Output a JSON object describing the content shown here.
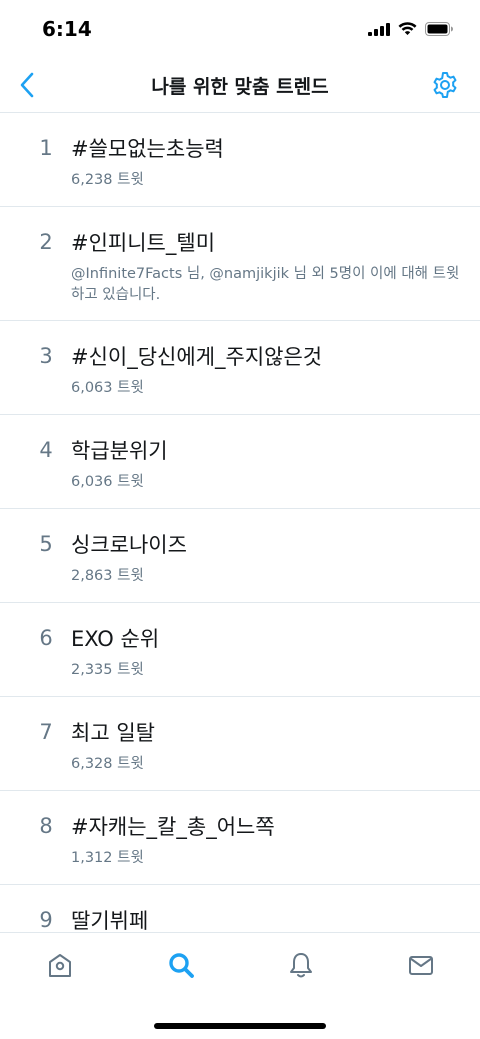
{
  "status_bar": {
    "time": "6:14"
  },
  "header": {
    "title": "나를 위한 맞춤 트렌드"
  },
  "trends": [
    {
      "rank": "1",
      "name": "#쓸모없는초능력",
      "meta": "6,238 트윗"
    },
    {
      "rank": "2",
      "name": "#인피니트_텔미",
      "meta": "@Infinite7Facts 님, @namjikjik 님 외 5명이 이에 대해 트윗하고 있습니다."
    },
    {
      "rank": "3",
      "name": "#신이_당신에게_주지않은것",
      "meta": "6,063 트윗"
    },
    {
      "rank": "4",
      "name": "학급분위기",
      "meta": "6,036 트윗"
    },
    {
      "rank": "5",
      "name": "싱크로나이즈",
      "meta": "2,863 트윗"
    },
    {
      "rank": "6",
      "name": "EXO 순위",
      "meta": "2,335 트윗"
    },
    {
      "rank": "7",
      "name": "최고 일탈",
      "meta": "6,328 트윗"
    },
    {
      "rank": "8",
      "name": "#자캐는_칼_총_어느쪽",
      "meta": "1,312 트윗"
    },
    {
      "rank": "9",
      "name": "딸기뷔페",
      "meta": ""
    }
  ],
  "tabs": [
    {
      "icon": "home-icon"
    },
    {
      "icon": "search-icon"
    },
    {
      "icon": "bell-icon"
    },
    {
      "icon": "mail-icon"
    }
  ],
  "colors": {
    "accent": "#1da1f2",
    "secondary_text": "#657786",
    "divider": "#e1e8ed",
    "tab_inactive": "#657786"
  }
}
